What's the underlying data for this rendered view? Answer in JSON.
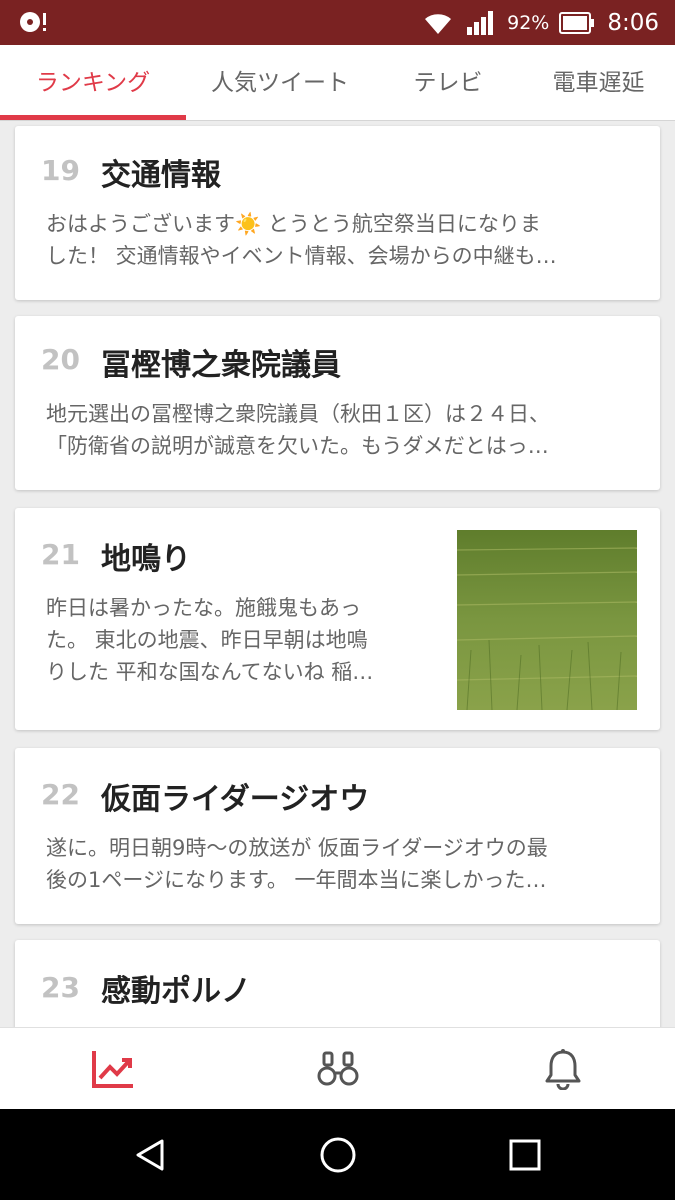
{
  "status": {
    "battery": "92%",
    "time": "8:06"
  },
  "tabs": [
    {
      "label": "ランキング",
      "active": true
    },
    {
      "label": "人気ツイート"
    },
    {
      "label": "テレビ"
    },
    {
      "label": "電車遅延"
    }
  ],
  "items": [
    {
      "rank": "19",
      "title": "交通情報",
      "excerpt": [
        "おはようございます☀️ とうとう航空祭当日になりま",
        "した！ 交通情報やイベント情報、会場からの中継も…"
      ]
    },
    {
      "rank": "20",
      "title": "冨樫博之衆院議員",
      "excerpt": [
        "地元選出の冨樫博之衆院議員（秋田１区）は２４日、",
        "「防衛省の説明が誠意を欠いた。もうダメだとはっ…"
      ]
    },
    {
      "rank": "21",
      "title": "地鳴り",
      "excerpt": [
        "昨日は暑かったな。施餓鬼もあっ",
        "た。 東北の地震、昨日早朝は地鳴",
        "りした 平和な国なんてないね 稲…"
      ],
      "thumbnail": "rice-field-photo"
    },
    {
      "rank": "22",
      "title": "仮面ライダージオウ",
      "excerpt": [
        "遂に。明日朝9時〜の放送が 仮面ライダージオウの最",
        "後の1ページになります。 一年間本当に楽しかった…"
      ]
    },
    {
      "rank": "23",
      "title": "感動ポルノ",
      "excerpt": []
    }
  ],
  "bottom_nav": [
    {
      "icon": "trending-chart-icon",
      "active": true
    },
    {
      "icon": "binoculars-icon"
    },
    {
      "icon": "bell-icon"
    }
  ],
  "system_nav": [
    {
      "icon": "back-icon"
    },
    {
      "icon": "home-icon"
    },
    {
      "icon": "recents-icon"
    }
  ],
  "colors": {
    "status_bar": "#7a2222",
    "accent": "#e03a48"
  }
}
